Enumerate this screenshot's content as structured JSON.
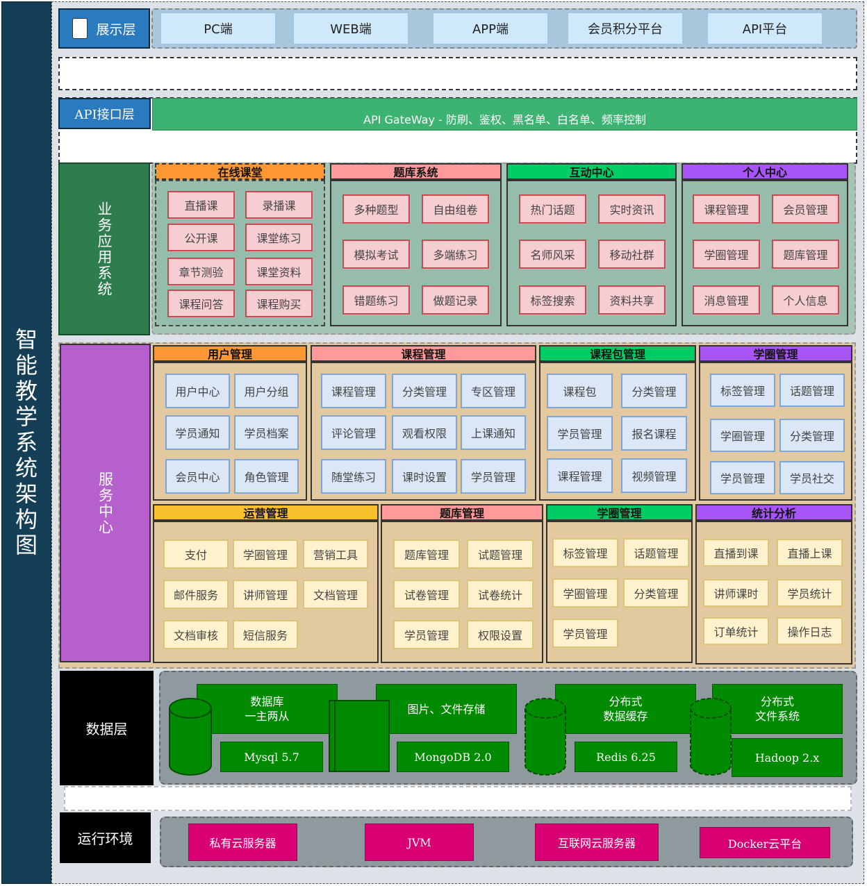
{
  "title": "智能教学系统架构图",
  "presentation": {
    "label": "展示层",
    "items": [
      "PC端",
      "WEB端",
      "APP端",
      "会员积分平台",
      "API平台"
    ]
  },
  "api_layer": {
    "label": "API接口层",
    "gateway": "API GateWay - 防刷、鉴权、黑名单、白名单、频率控制"
  },
  "business": {
    "label": "业务应用系统",
    "sections": [
      {
        "title": "在线课堂",
        "color": "#fd9734",
        "items": [
          "直播课",
          "录播课",
          "公开课",
          "课堂练习",
          "章节测验",
          "课堂资料",
          "课程问答",
          "课程购买"
        ]
      },
      {
        "title": "题库系统",
        "color": "#ff9a9a",
        "items": [
          "多种题型",
          "自由组卷",
          "模拟考试",
          "多端练习",
          "错题练习",
          "做题记录"
        ]
      },
      {
        "title": "互动中心",
        "color": "#00cc66",
        "items": [
          "热门话题",
          "实时资讯",
          "名师风采",
          "移动社群",
          "标签搜索",
          "资料共享"
        ]
      },
      {
        "title": "个人中心",
        "color": "#a855f7",
        "items": [
          "课程管理",
          "会员管理",
          "学圈管理",
          "题库管理",
          "消息管理",
          "个人信息"
        ]
      }
    ]
  },
  "service": {
    "label": "服务中心",
    "sections": [
      {
        "title": "用户管理",
        "color": "#fd9734",
        "items": [
          "用户中心",
          "用户分组",
          "学员通知",
          "学员档案",
          "会员中心",
          "角色管理"
        ]
      },
      {
        "title": "课程管理",
        "color": "#ff9a9a",
        "items": [
          "课程管理",
          "分类管理",
          "专区管理",
          "评论管理",
          "观看权限",
          "上课通知",
          "随堂练习",
          "课时设置",
          "学员管理"
        ]
      },
      {
        "title": "课程包管理",
        "color": "#00cc66",
        "items": [
          "课程包",
          "分类管理",
          "学员管理",
          "报名课程",
          "课程管理",
          "视频管理"
        ]
      },
      {
        "title": "学圈管理",
        "color": "#a855f7",
        "items": [
          "标签管理",
          "话题管理",
          "学圈管理",
          "分类管理",
          "学员管理",
          "学员社交"
        ]
      },
      {
        "title": "运营管理",
        "color": "#fbc02d",
        "items": [
          "支付",
          "学圈管理",
          "营销工具",
          "邮件服务",
          "讲师管理",
          "文档管理",
          "文档审核",
          "短信服务"
        ]
      },
      {
        "title": "题库管理",
        "color": "#ff9a9a",
        "items": [
          "题库管理",
          "试题管理",
          "试卷管理",
          "试卷统计",
          "学员管理",
          "权限设置"
        ]
      },
      {
        "title": "学圈管理",
        "color": "#00cc66",
        "items": [
          "标签管理",
          "话题管理",
          "学圈管理",
          "分类管理",
          "学员管理"
        ]
      },
      {
        "title": "统计分析",
        "color": "#a855f7",
        "items": [
          "直播到课",
          "直播上课",
          "讲师课时",
          "学员统计",
          "订单统计",
          "操作日志"
        ]
      }
    ]
  },
  "data_layer": {
    "label": "数据层",
    "stores": [
      {
        "name": "数据库\n一主两从",
        "tech": "Mysql 5.7"
      },
      {
        "name": "图片、文件存储",
        "tech": "MongoDB  2.0"
      },
      {
        "name": "分布式\n数据缓存",
        "tech": "Redis 6.25"
      },
      {
        "name": "分布式\n文件系统",
        "tech": "Hadoop 2.x"
      }
    ]
  },
  "runtime": {
    "label": "运行环境",
    "items": [
      "私有云服务器",
      "JVM",
      "互联网云服务器",
      "Docker云平台"
    ]
  },
  "colors": {
    "sidebar": "#143f57",
    "presentation_label": "#2a7ac0",
    "gateway": "#3cb371",
    "business_label": "#2e7d4f",
    "service_label": "#b660cd",
    "data_green": "#008a00",
    "runtime_pink": "#d80073"
  }
}
